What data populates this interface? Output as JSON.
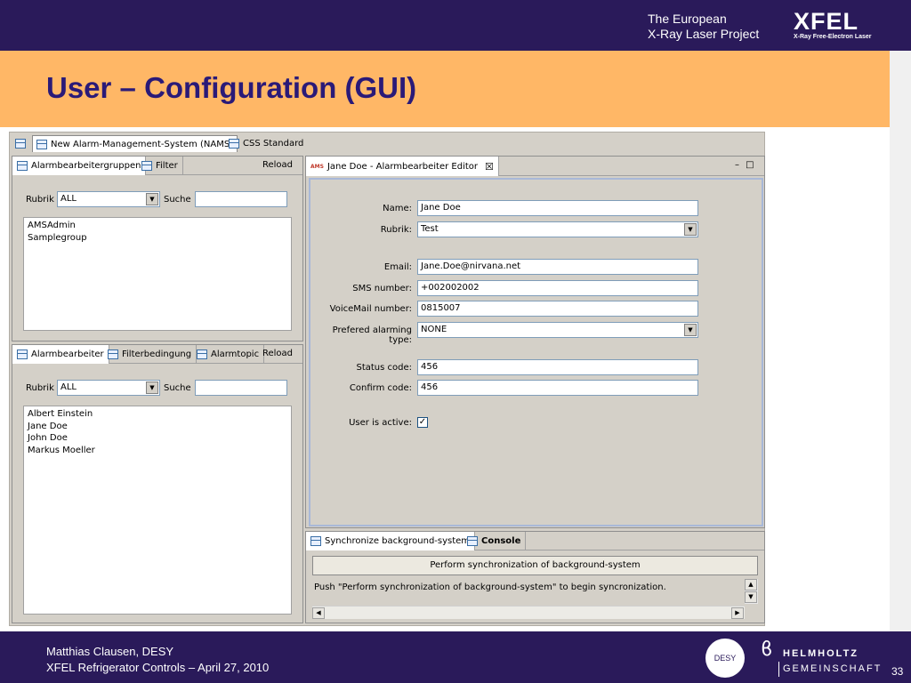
{
  "header": {
    "org_line1": "The European",
    "org_line2": "X-Ray Laser Project",
    "logo_main": "XFEL",
    "logo_sub": "X-Ray Free-Electron Laser"
  },
  "slide_title": "User – Configuration (GUI)",
  "footer": {
    "author": "Matthias Clausen, DESY",
    "event": "XFEL Refrigerator Controls – April 27, 2010",
    "desy_logo": "DESY",
    "helmholtz_line1": "HELMHOLTZ",
    "helmholtz_line2": "GEMEINSCHAFT",
    "page_number": "33"
  },
  "perspectives": {
    "items": [
      "New Alarm-Management-System (NAMS)",
      "CSS Standard"
    ]
  },
  "groups_panel": {
    "tabs": [
      "Alarmbearbeitergruppen",
      "Filter"
    ],
    "reload": "Reload",
    "rubrik_label": "Rubrik",
    "rubrik_value": "ALL",
    "suche_label": "Suche",
    "suche_value": "",
    "items": [
      "AMSAdmin",
      "Samplegroup"
    ]
  },
  "users_panel": {
    "tabs": [
      "Alarmbearbeiter",
      "Filterbedingung",
      "Alarmtopic"
    ],
    "reload": "Reload",
    "rubrik_label": "Rubrik",
    "rubrik_value": "ALL",
    "suche_label": "Suche",
    "suche_value": "",
    "items": [
      "Albert Einstein",
      "Jane Doe",
      "John Doe",
      "Markus Moeller"
    ]
  },
  "editor": {
    "tab_title": "Jane Doe - Alarmbearbeiter Editor",
    "tab_icon_text": "AMS",
    "close_glyph": "☒",
    "minmax": "– □",
    "fields": {
      "name_label": "Name:",
      "name_value": "Jane Doe",
      "rubrik_label": "Rubrik:",
      "rubrik_value": "Test",
      "email_label": "Email:",
      "email_value": "Jane.Doe@nirvana.net",
      "sms_label": "SMS number:",
      "sms_value": "+002002002",
      "voicemail_label": "VoiceMail number:",
      "voicemail_value": "0815007",
      "alarming_label": "Prefered alarming type:",
      "alarming_value": "NONE",
      "status_label": "Status code:",
      "status_value": "456",
      "confirm_label": "Confirm code:",
      "confirm_value": "456",
      "active_label": "User is active:",
      "active_check": "✓"
    }
  },
  "bottom_panel": {
    "tabs": [
      "Synchronize background-system",
      "Console"
    ],
    "sync_button": "Perform synchronization of background-system",
    "console_text": "Push \"Perform synchronization of background-system\" to begin syncronization."
  },
  "colors": {
    "header_bg": "#2a1a5a",
    "title_band": "#ffb766",
    "title_text": "#2a1a78",
    "app_bg": "#d4d0c8"
  }
}
